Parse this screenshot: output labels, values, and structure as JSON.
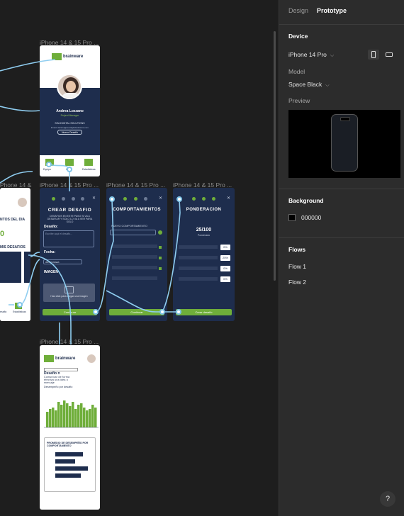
{
  "canvas": {
    "frame_labels": [
      "iPhone 14 & 15 Pro ...",
      "iPhone 14 & 15 Pro ...",
      "iPhone 14 & 15 Pro ...",
      "iPhone 14 & 15 Pro ...",
      "iPhone 14 & 15 Pro ...",
      "iPhone 14 & 15 Pro ..."
    ],
    "profile": {
      "logo": "brainware",
      "name": "Andrea Lozzano",
      "role": "Project Manager",
      "company": "SEA DIGITAL SOLUTIONS",
      "email": "Email: ifazana@seadigitalsolutions.com",
      "button": "Nuevo Desafio",
      "nav": [
        "Equipo",
        "Inicio",
        "Estadisticas"
      ]
    },
    "partial": {
      "line1": "NTOS DEL DIA",
      "value": "0",
      "line2": "MIS DESAFIOS",
      "nav": [
        "esafio",
        "Estadisticas"
      ]
    },
    "crear": {
      "title": "CREAR DESAFIO",
      "subtitle": "DESAFIOS EN ESTE PASO SI VA A DESAFIAR Y SOLO LO VA A VER PARA SOLO",
      "desafio_label": "Desafio:",
      "desafio_placeholder": "Escribe aqui el desafio...",
      "fecha_label": "Fecha:",
      "fecha_value": "dd/mm/aaaa",
      "imagen_label": "IMAGEN",
      "upload_text": "Haz click para cargar una imagen",
      "button": "Continuar"
    },
    "comport": {
      "title": "COMPORTAMIENTOS",
      "nuevo": "NUEVO COMPORTAMIENTO",
      "button": "Continuar"
    },
    "ponder": {
      "title": "PONDERACION",
      "score": "25/100",
      "score_label": "Ponderado",
      "pcts": [
        "0%",
        "25%",
        "0%",
        "0%"
      ],
      "button": "Crear desafio"
    },
    "stats": {
      "logo": "brainware",
      "desafio_label": "Desafio n",
      "desafio_text": "Comunicar de forma efectiva una idea o mensaje",
      "chart1_title": "Desempeño por desafio",
      "chart2_title": "PROMEDIO DE DESEMPEÑO POR COMPORTAMIENTO"
    }
  },
  "panel": {
    "tabs": [
      "Design",
      "Prototype"
    ],
    "device_title": "Device",
    "device_value": "iPhone 14 Pro",
    "model_label": "Model",
    "model_value": "Space Black",
    "preview_label": "Preview",
    "background_title": "Background",
    "background_value": "000000",
    "flows_title": "Flows",
    "flows": [
      "Flow 1",
      "Flow 2"
    ],
    "help": "?"
  }
}
